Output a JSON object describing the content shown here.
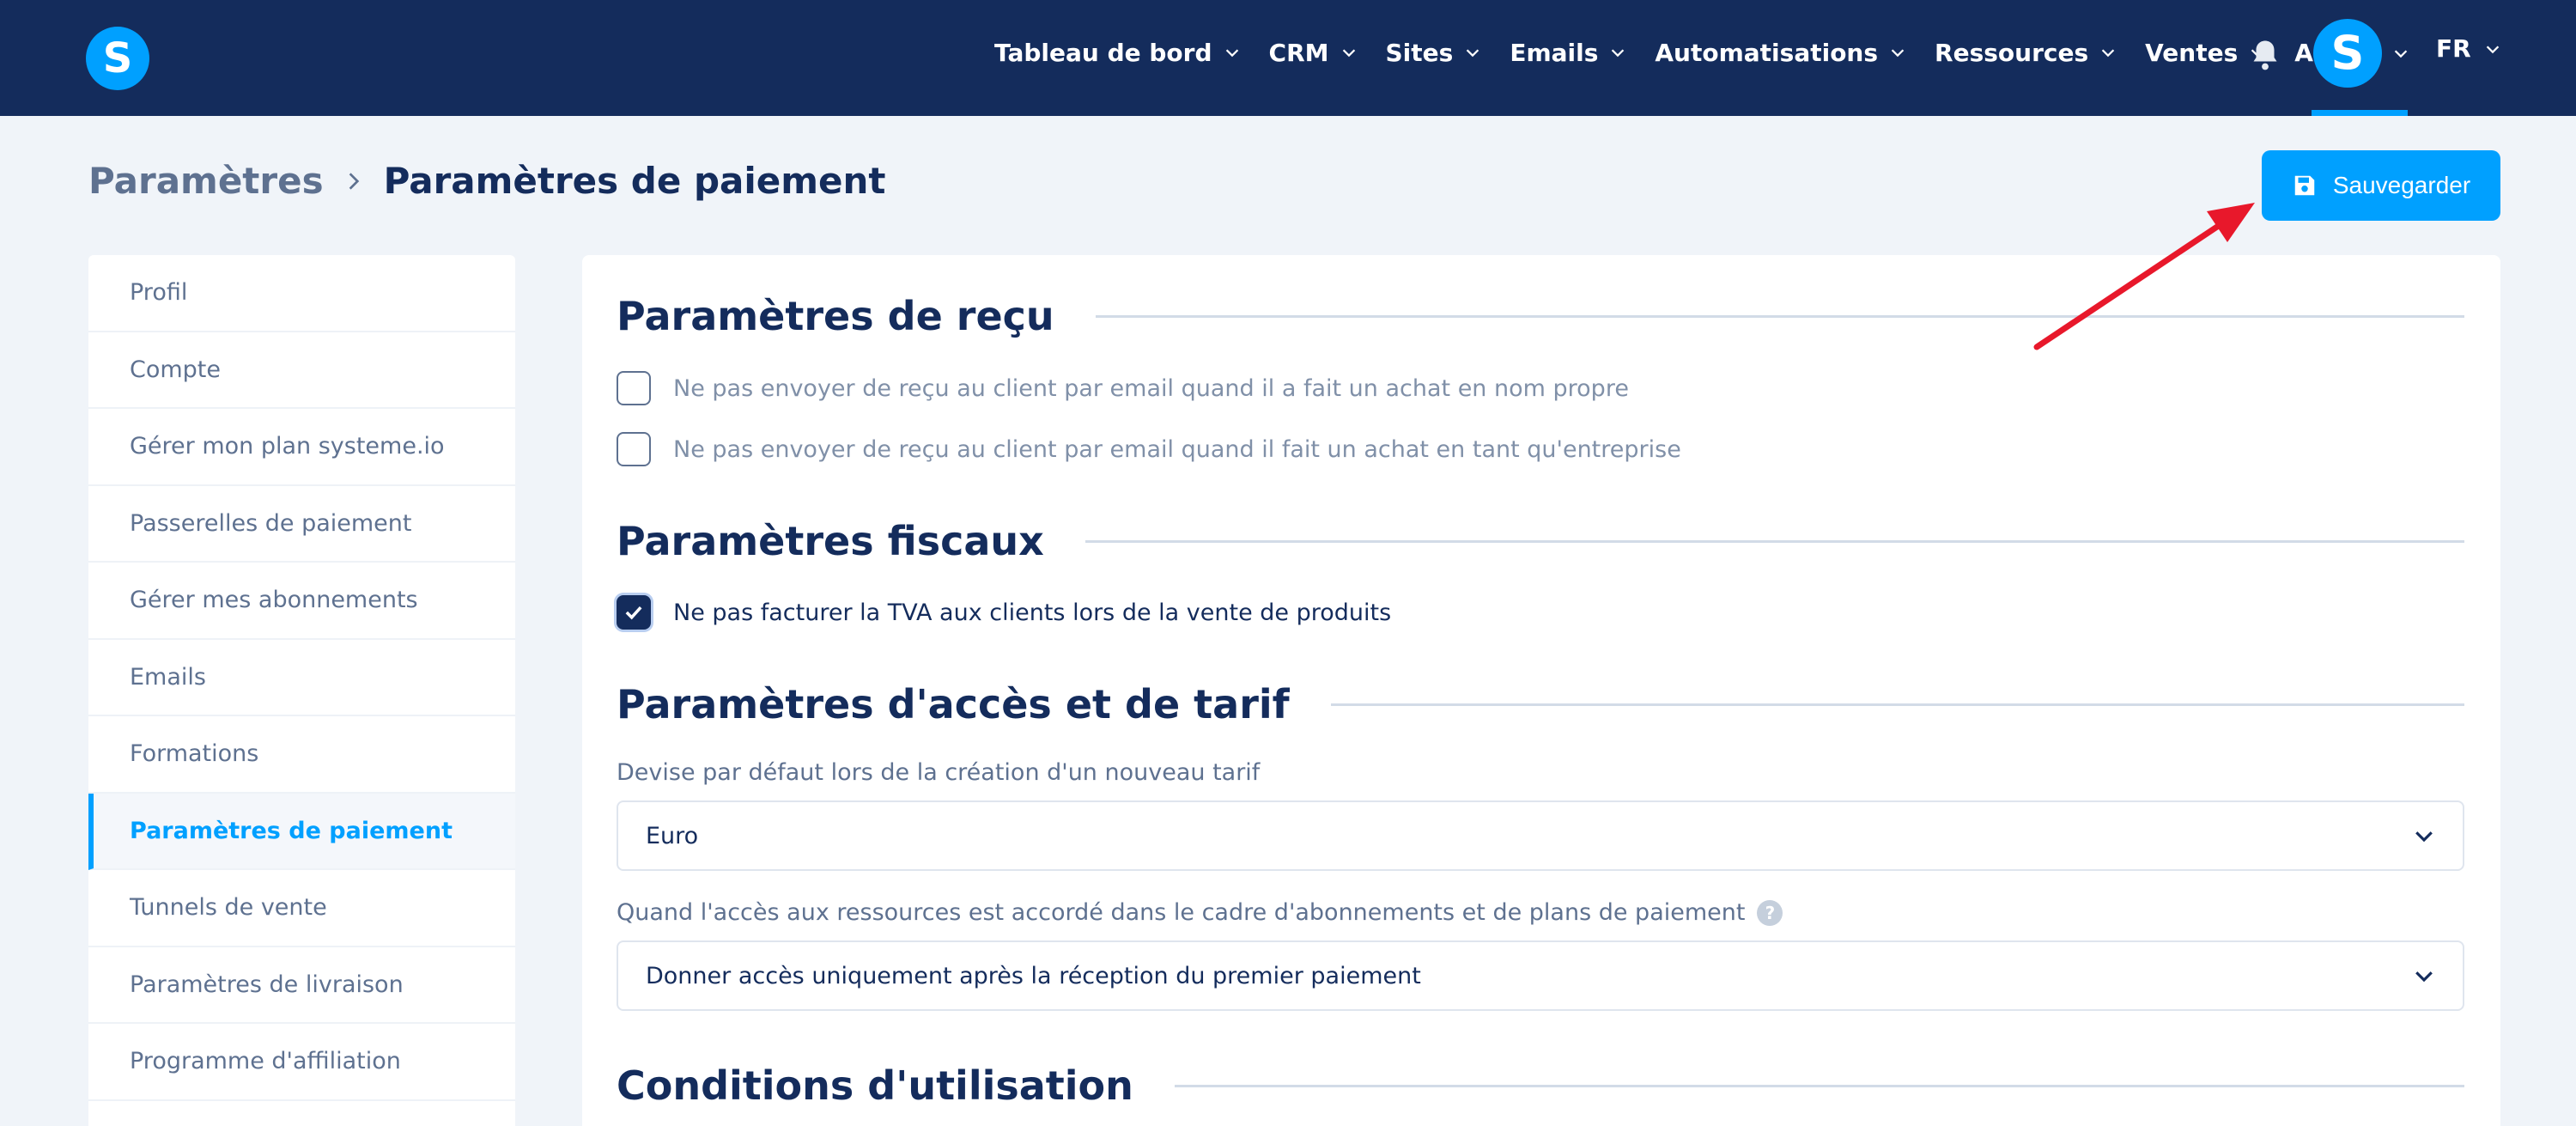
{
  "nav": {
    "logo_letter": "S",
    "items": [
      {
        "label": "Tableau de bord",
        "dropdown": true
      },
      {
        "label": "CRM",
        "dropdown": true
      },
      {
        "label": "Sites",
        "dropdown": true
      },
      {
        "label": "Emails",
        "dropdown": true
      },
      {
        "label": "Automatisations",
        "dropdown": true
      },
      {
        "label": "Ressources",
        "dropdown": true
      },
      {
        "label": "Ventes",
        "dropdown": true
      },
      {
        "label": "Aide",
        "dropdown": false
      }
    ],
    "notification_icon": "bell-icon",
    "avatar_letter": "S",
    "language": "FR"
  },
  "breadcrumb": {
    "parent": "Paramètres",
    "current": "Paramètres de paiement"
  },
  "toolbar": {
    "save_label": "Sauvegarder",
    "save_icon": "floppy-disk-icon"
  },
  "sidebar": {
    "items": [
      {
        "label": "Profil",
        "active": false
      },
      {
        "label": "Compte",
        "active": false
      },
      {
        "label": "Gérer mon plan systeme.io",
        "active": false
      },
      {
        "label": "Passerelles de paiement",
        "active": false
      },
      {
        "label": "Gérer mes abonnements",
        "active": false
      },
      {
        "label": "Emails",
        "active": false
      },
      {
        "label": "Formations",
        "active": false
      },
      {
        "label": "Paramètres de paiement",
        "active": true
      },
      {
        "label": "Tunnels de vente",
        "active": false
      },
      {
        "label": "Paramètres de livraison",
        "active": false
      },
      {
        "label": "Programme d'affiliation",
        "active": false
      }
    ]
  },
  "receipt": {
    "title": "Paramètres de reçu",
    "options": [
      {
        "label": "Ne pas envoyer de reçu au client par email quand il a fait un achat en nom propre",
        "checked": false
      },
      {
        "label": "Ne pas envoyer de reçu au client par email quand il fait un achat en tant qu'entreprise",
        "checked": false
      }
    ]
  },
  "fiscal": {
    "title": "Paramètres fiscaux",
    "options": [
      {
        "label": "Ne pas facturer la TVA aux clients lors de la vente de produits",
        "checked": true
      }
    ]
  },
  "access": {
    "title": "Paramètres d'accès et de tarif",
    "currency_label": "Devise par défaut lors de la création d'un nouveau tarif",
    "currency_value": "Euro",
    "access_label": "Quand l'accès aux ressources est accordé dans le cadre d'abonnements et de plans de paiement",
    "access_help": "?",
    "access_value": "Donner accès uniquement après la réception du premier paiement"
  },
  "terms": {
    "title": "Conditions d'utilisation"
  },
  "colors": {
    "navbar": "#142c5c",
    "accent": "#00a0ff",
    "page_bg": "#f0f4f9",
    "annotation_arrow": "#e8182b"
  }
}
